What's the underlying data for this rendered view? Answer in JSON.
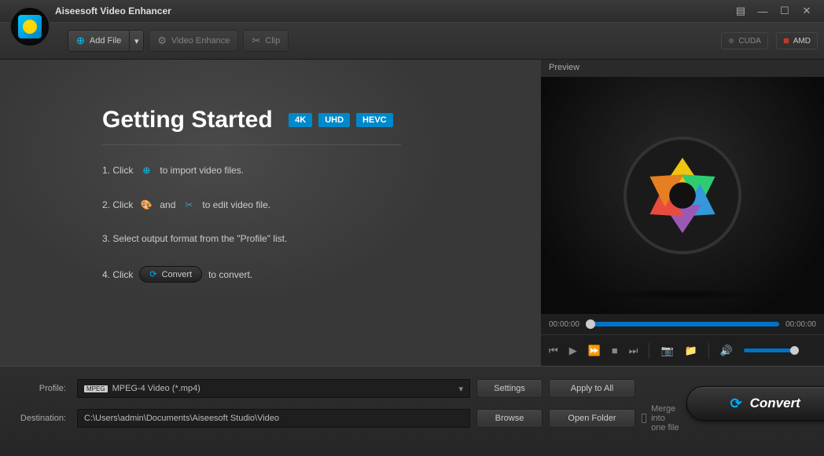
{
  "app_title": "Aiseesoft Video Enhancer",
  "toolbar": {
    "add_file": "Add File",
    "video_enhance": "Video Enhance",
    "clip": "Clip",
    "cuda": "CUDA",
    "amd": "AMD"
  },
  "getting_started": {
    "title": "Getting Started",
    "badges": [
      "4K",
      "UHD",
      "HEVC"
    ],
    "step1_a": "1. Click",
    "step1_b": "to import video files.",
    "step2_a": "2. Click",
    "step2_and": "and",
    "step2_b": "to edit video file.",
    "step3": "3. Select output format from the \"Profile\" list.",
    "step4_a": "4. Click",
    "step4_pill": "Convert",
    "step4_b": "to convert."
  },
  "preview": {
    "label": "Preview",
    "time_start": "00:00:00",
    "time_end": "00:00:00"
  },
  "bottom": {
    "profile_label": "Profile:",
    "profile_value": "MPEG-4 Video (*.mp4)",
    "settings": "Settings",
    "apply_all": "Apply to All",
    "destination_label": "Destination:",
    "destination_value": "C:\\Users\\admin\\Documents\\Aiseesoft Studio\\Video",
    "browse": "Browse",
    "open_folder": "Open Folder",
    "merge": "Merge into one file",
    "convert": "Convert"
  }
}
